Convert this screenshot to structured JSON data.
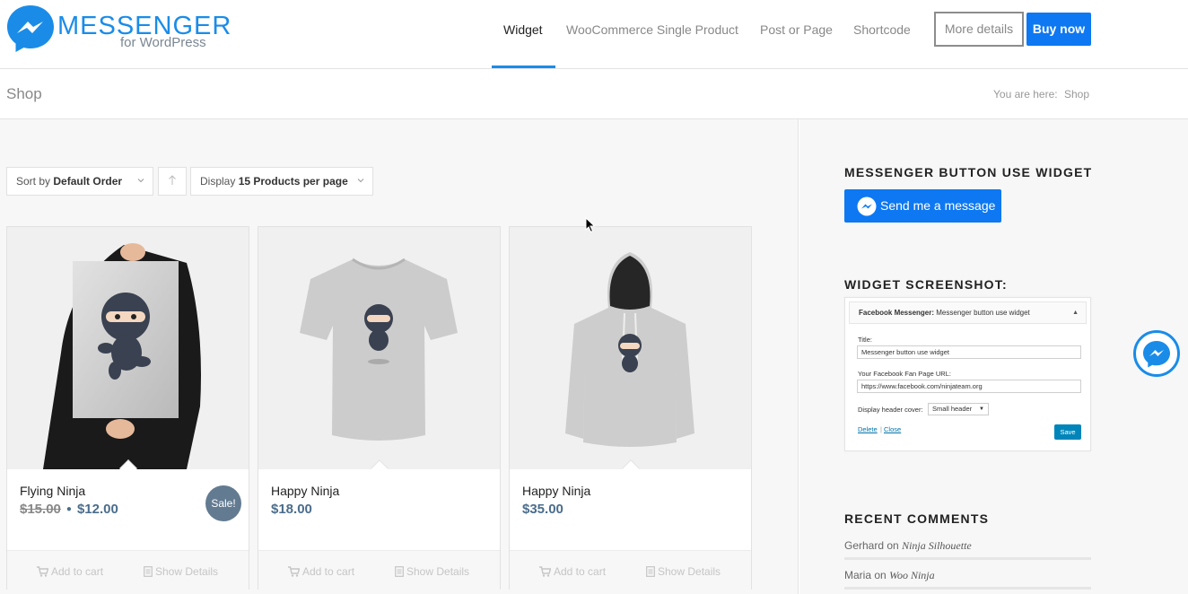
{
  "header": {
    "logo_main": "MESSENGER",
    "logo_sub": "for WordPress",
    "nav": [
      {
        "label": "Widget",
        "active": true
      },
      {
        "label": "WooCommerce Single Product",
        "active": false
      },
      {
        "label": "Post or Page",
        "active": false
      },
      {
        "label": "Shortcode",
        "active": false
      }
    ],
    "more_details": "More details",
    "buy_now": "Buy now"
  },
  "titlebar": {
    "title": "Shop",
    "breadcrumb_prefix": "You are here:",
    "breadcrumb_current": "Shop"
  },
  "controls": {
    "sort_prefix": "Sort by",
    "sort_value": "Default Order",
    "direction_icon": "arrow-up-icon",
    "display_prefix": "Display",
    "display_value": "15 Products per page"
  },
  "products": [
    {
      "name": "Flying Ninja",
      "old_price": "$15.00",
      "price": "$12.00",
      "sale_badge": "Sale!",
      "add_to_cart": "Add to cart",
      "show_details": "Show Details"
    },
    {
      "name": "Happy Ninja",
      "price": "$18.00",
      "add_to_cart": "Add to cart",
      "show_details": "Show Details"
    },
    {
      "name": "Happy Ninja",
      "price": "$35.00",
      "add_to_cart": "Add to cart",
      "show_details": "Show Details"
    }
  ],
  "sidebar": {
    "widget_title": "MESSENGER BUTTON USE WIDGET",
    "send_button": "Send me a message",
    "screenshot_title": "WIDGET SCREENSHOT:",
    "screenshot": {
      "bar_bold": "Facebook Messenger:",
      "bar_rest": "Messenger button use widget",
      "title_label": "Title:",
      "title_value": "Messenger button use widget",
      "url_label": "Your Facebook Fan Page URL:",
      "url_value": "https://www.facebook.com/ninjateam.org",
      "cover_label": "Display header cover:",
      "cover_value": "Small header",
      "delete": "Delete",
      "separator": "|",
      "close": "Close",
      "save": "Save"
    },
    "recent_title": "RECENT COMMENTS",
    "recent": [
      {
        "author": "Gerhard",
        "on": "on",
        "post": "Ninja Silhouette"
      },
      {
        "author": "Maria",
        "on": "on",
        "post": "Woo Ninja"
      }
    ]
  },
  "colors": {
    "accent": "#0d78f2",
    "brand": "#1a8ce8",
    "price": "#4a6d8c",
    "sale": "#637b91"
  }
}
